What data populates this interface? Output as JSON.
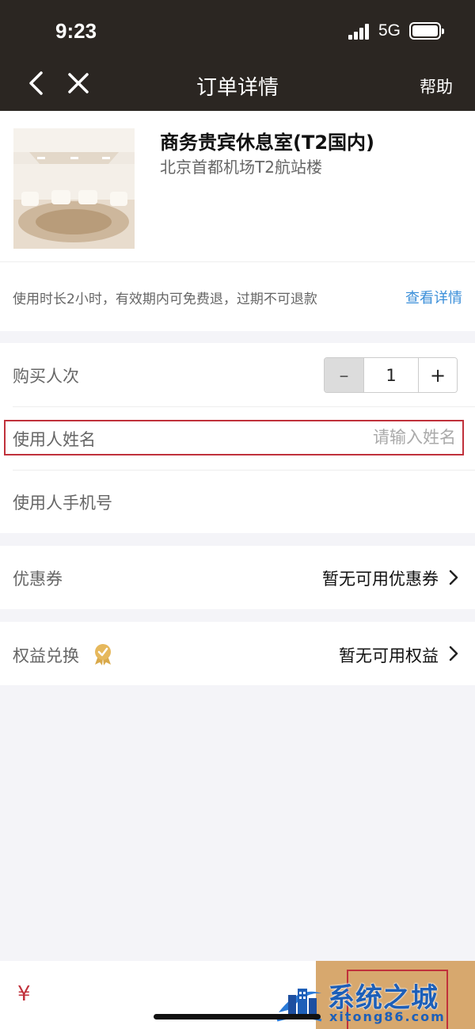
{
  "status_bar": {
    "time": "9:23",
    "network": "5G"
  },
  "nav": {
    "title": "订单详情",
    "help_label": "帮助"
  },
  "product": {
    "title": "商务贵宾休息室(T2国内)",
    "location": "北京首都机场T2航站楼",
    "policy": "使用时长2小时，有效期内可免费退，过期不可退款",
    "detail_link": "查看详情"
  },
  "form": {
    "quantity_label": "购买人次",
    "quantity_value": "1",
    "minus_label": "–",
    "plus_label": "+",
    "name_label": "使用人姓名",
    "name_placeholder": "请输入姓名",
    "phone_label": "使用人手机号"
  },
  "coupon": {
    "label": "优惠券",
    "value": "暂无可用优惠券"
  },
  "rights": {
    "label": "权益兑换",
    "value": "暂无可用权益"
  },
  "bottom": {
    "currency": "¥"
  },
  "watermark": {
    "title": "系统之城",
    "subtitle": "xitong86.com"
  },
  "colors": {
    "header_bg": "#2b2622",
    "link": "#3b8fd9",
    "highlight_border": "#c0313b",
    "submit_bg": "#d7a86e"
  }
}
